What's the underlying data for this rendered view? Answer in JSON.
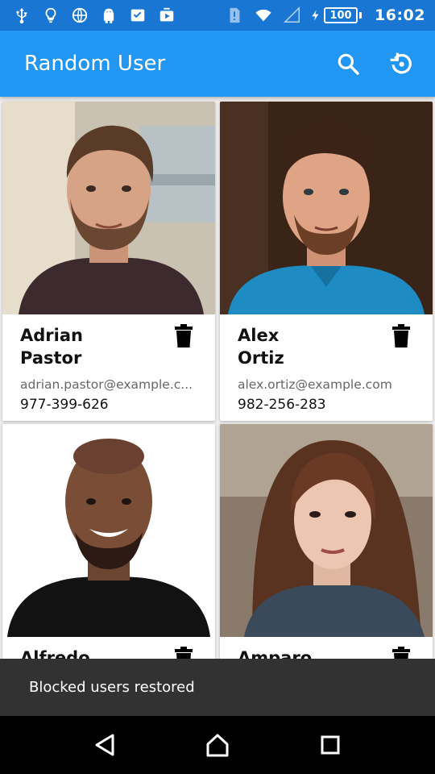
{
  "status_bar": {
    "battery": "100",
    "time": "16:02",
    "icons": [
      "usb-icon",
      "bulb-icon",
      "globe-icon",
      "android-icon",
      "inbox-check-icon",
      "media-icon",
      "alert-sim-icon",
      "wifi-icon",
      "signal-icon",
      "charging-icon"
    ]
  },
  "app_bar": {
    "title": "Random User",
    "actions": [
      "search-icon",
      "restore-icon"
    ]
  },
  "users": [
    {
      "first": "Adrian",
      "last": "Pastor",
      "email": "adrian.pastor@example.c...",
      "phone": "977-399-626"
    },
    {
      "first": "Alex",
      "last": "Ortiz",
      "email": "alex.ortiz@example.com",
      "phone": "982-256-283"
    },
    {
      "first": "Alfredo",
      "last": "",
      "email": "",
      "phone": ""
    },
    {
      "first": "Amparo",
      "last": "",
      "email": "",
      "phone": ""
    }
  ],
  "snackbar": {
    "message": "Blocked users restored"
  },
  "colors": {
    "primary": "#2196F3",
    "primary_dark": "#1976D2",
    "snackbar": "#323232",
    "background": "#EEEEEE"
  }
}
